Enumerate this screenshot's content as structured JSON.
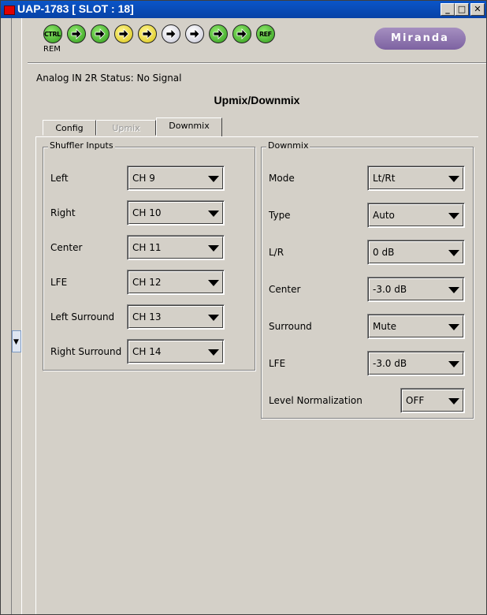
{
  "window": {
    "title": "UAP-1783 [ SLOT : 18]"
  },
  "titlebar_buttons": {
    "minimize": "_",
    "maximize": "□",
    "close": "✕"
  },
  "status_leds": [
    {
      "label": "CTRL",
      "color": "green"
    },
    {
      "label": "",
      "color": "green"
    },
    {
      "label": "",
      "color": "green"
    },
    {
      "label": "",
      "color": "yellow"
    },
    {
      "label": "",
      "color": "yellow"
    },
    {
      "label": "",
      "color": "white"
    },
    {
      "label": "",
      "color": "white"
    },
    {
      "label": "",
      "color": "green"
    },
    {
      "label": "",
      "color": "green"
    },
    {
      "label": "REF",
      "color": "green"
    }
  ],
  "rem_label": "REM",
  "logo": "Miranda",
  "status_line": "Analog IN 2R Status: No Signal",
  "page_title": "Upmix/Downmix",
  "tabs": [
    {
      "label": "Config",
      "state": "normal"
    },
    {
      "label": "Upmix",
      "state": "disabled"
    },
    {
      "label": "Downmix",
      "state": "active"
    }
  ],
  "shuffler": {
    "title": "Shuffler Inputs",
    "rows": [
      {
        "label": "Left",
        "value": "CH 9"
      },
      {
        "label": "Right",
        "value": "CH 10"
      },
      {
        "label": "Center",
        "value": "CH 11"
      },
      {
        "label": "LFE",
        "value": "CH 12"
      },
      {
        "label": "Left Surround",
        "value": "CH 13"
      },
      {
        "label": "Right Surround",
        "value": "CH 14"
      }
    ]
  },
  "downmix": {
    "title": "Downmix",
    "rows": [
      {
        "label": "Mode",
        "value": "Lt/Rt"
      },
      {
        "label": "Type",
        "value": "Auto"
      },
      {
        "label": "L/R",
        "value": "0 dB"
      },
      {
        "label": "Center",
        "value": "-3.0 dB"
      },
      {
        "label": "Surround",
        "value": "Mute"
      },
      {
        "label": "LFE",
        "value": "-3.0 dB"
      }
    ],
    "normalization": {
      "label": "Level Normalization",
      "value": "OFF"
    }
  },
  "colors": {
    "titlebar": "#0a4fc0",
    "accent_red": "#e00000",
    "led_green": "#3db021",
    "led_yellow": "#e8d62a",
    "logo_purple": "#8a6fae",
    "face": "#d4d0c8"
  }
}
